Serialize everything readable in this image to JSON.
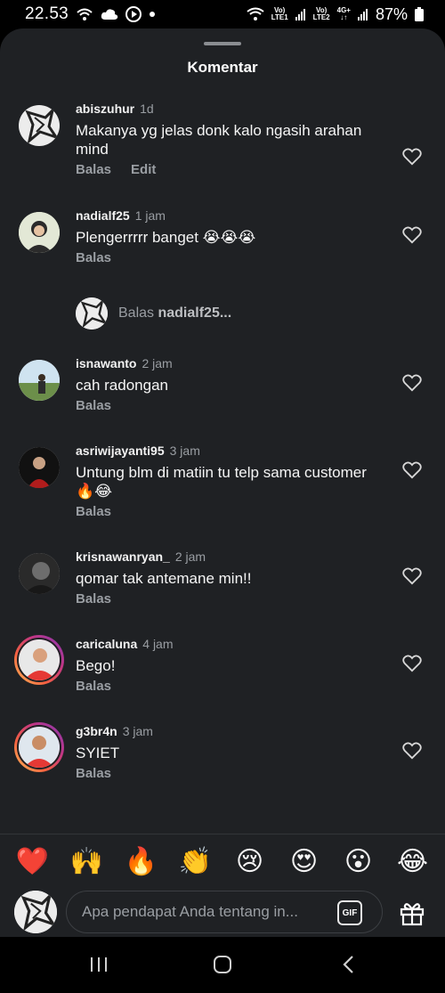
{
  "status_bar": {
    "time": "22.53",
    "sim1_top": "Vo)",
    "sim1_bottom": "LTE1",
    "sim2_top": "Vo)",
    "sim2_bottom": "LTE2",
    "net_type": "4G+",
    "battery": "87%"
  },
  "sheet": {
    "title": "Komentar"
  },
  "comments": [
    {
      "user": "abiszuhur",
      "time": "1d",
      "text": "Makanya yg jelas donk kalo ngasih arahan mind",
      "reply": "Balas",
      "edit": "Edit"
    },
    {
      "user": "nadialf25",
      "time": "1 jam",
      "text": "Plengerrrrr banget 😭😭😭",
      "reply": "Balas"
    },
    {
      "user": "isnawanto",
      "time": "2 jam",
      "text": "cah radongan",
      "reply": "Balas"
    },
    {
      "user": "asriwijayanti95",
      "time": "3 jam",
      "text": "Untung blm di matiin tu telp sama customer 🔥😂",
      "reply": "Balas"
    },
    {
      "user": "krisnawanryan_",
      "time": "2 jam",
      "text": "qomar tak antemane min!!",
      "reply": "Balas"
    },
    {
      "user": "caricaluna",
      "time": "4 jam",
      "text": "Bego!",
      "reply": "Balas"
    },
    {
      "user": "g3br4n",
      "time": "3 jam",
      "text": "SYIET",
      "reply": "Balas"
    }
  ],
  "reply_prompt": {
    "prefix": "Balas",
    "target": "nadialf25..."
  },
  "emoji_bar": [
    "❤️",
    "🙌",
    "🔥",
    "👏",
    "😢",
    "😍",
    "😮",
    "😂"
  ],
  "input": {
    "placeholder": "Apa pendapat Anda tentang in...",
    "gif_label": "GIF"
  },
  "colors": {
    "sheet_bg": "#1f2124",
    "muted_text": "#9a9ea3",
    "story_ring": "#c13584"
  },
  "icons": {
    "like": "heart-outline-icon",
    "gift": "gift-icon",
    "nav": [
      "recent-apps-icon",
      "home-icon",
      "back-icon"
    ]
  }
}
